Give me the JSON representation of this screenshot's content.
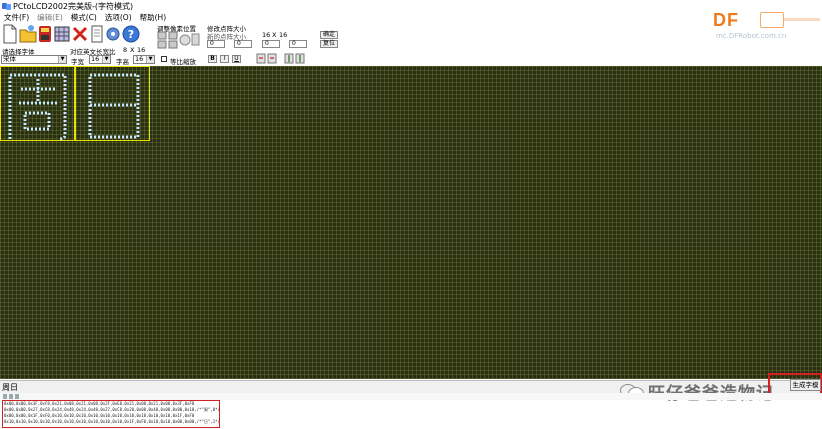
{
  "window": {
    "title": "PCtoLCD2002完美版-(字符模式)"
  },
  "watermark": {
    "brand": "DF",
    "url": "mc.DFRobot.com.cn"
  },
  "menu": [
    "文件(F)",
    "编辑(E)",
    "模式(C)",
    "选项(O)",
    "帮助(H)"
  ],
  "toolbar": {
    "adjust_label": "调整像素位置",
    "modify_size_label": "修改点阵大小",
    "new_size_label": "新的点阵大小",
    "size_w": "16",
    "size_sep": "X",
    "size_h": "16",
    "confirm_btn": "确定",
    "restore_btn": "复位",
    "font_label": "请选择字体",
    "font_value": "宋体",
    "ratio_label": "对应英文长宽比",
    "ratio_w": "8",
    "ratio_sep": "X",
    "ratio_h": "16",
    "width_label": "字宽",
    "width_value": "16",
    "height_label": "字高",
    "height_value": "16",
    "scale_label": "等比缩放",
    "bold_btn": "B",
    "italic_btn": "I",
    "underline_btn": "U",
    "spin_values": [
      "0",
      "0",
      "0",
      "0"
    ]
  },
  "canvas": {
    "characters": [
      "周",
      "日"
    ]
  },
  "status": {
    "input_text": "周日"
  },
  "actions": {
    "generate_btn": "生成字模"
  },
  "output": {
    "lines": [
      "0x00,0x00,0x3F,0xF8,0x21,0x08,0x21,0x08,0x2F,0xE8,0x21,0x08,0x21,0x08,0x3F,0xF8",
      "0x00,0x00,0x27,0xC8,0x24,0x48,0x24,0x48,0x27,0xC8,0x20,0x08,0x40,0x08,0x80,0x18,/*\"周\",0*/",
      "0x00,0x00,0x1F,0xF0,0x10,0x10,0x10,0x10,0x10,0x10,0x10,0x10,0x10,0x10,0x1F,0xF0",
      "0x10,0x10,0x10,0x10,0x10,0x10,0x10,0x10,0x10,0x10,0x1F,0xF0,0x10,0x10,0x00,0x00,/*\"日\",1*/"
    ]
  },
  "bottom_watermark": {
    "text": "旺仔爸爸造物记"
  }
}
